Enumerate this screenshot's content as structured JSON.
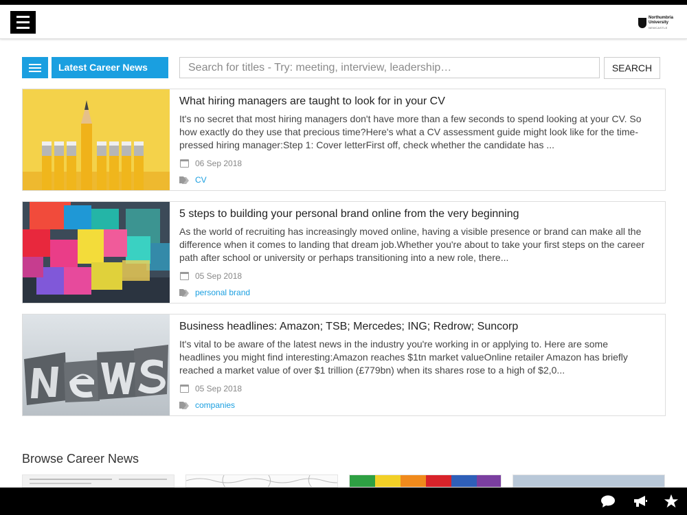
{
  "header": {
    "logo": {
      "line1": "Northumbria",
      "line2": "University",
      "line3": "NEWCASTLE"
    }
  },
  "toolbar": {
    "section_label": "Latest Career News",
    "search_placeholder": "Search for titles - Try: meeting, interview, leadership…",
    "search_value": "",
    "search_button": "SEARCH"
  },
  "articles": [
    {
      "title": "What hiring managers are taught to look for in your CV",
      "excerpt": "It's no secret that most hiring managers don't have more than a few seconds to spend looking at your CV. So how exactly do they use that precious time?Here's what a CV assessment guide might look like for the time-pressed hiring manager:Step 1: Cover letterFirst off, check whether the candidate has ...",
      "date": "06 Sep 2018",
      "tag": "CV",
      "image": "pencils-image"
    },
    {
      "title": "5 steps to building your personal brand online from the very beginning",
      "excerpt": "As the world of recruiting has increasingly moved online, having a visible presence or brand can make all the difference when it comes to landing that dream job.Whether you're about to take your first steps on the career path after school or university or perhaps transitioning into a new role, there...",
      "date": "05 Sep 2018",
      "tag": "personal brand",
      "image": "colored-blocks-image"
    },
    {
      "title": "Business headlines: Amazon; TSB; Mercedes; ING; Redrow; Suncorp",
      "excerpt": "It's vital to be aware of the latest news in the industry you're working in or applying to. Here are some headlines you might find interesting:Amazon reaches $1tn market valueOnline retailer Amazon has briefly reached a market value of over $1 trillion (£779bn) when its shares rose to a high of $2,0...",
      "date": "05 Sep 2018",
      "tag": "companies",
      "image": "news-letterpress-image"
    }
  ],
  "browse": {
    "heading": "Browse Career News"
  },
  "bottom_bar": {
    "icons": [
      "chat-icon",
      "megaphone-icon",
      "star-icon"
    ]
  },
  "colors": {
    "accent": "#1a9fe0",
    "bar": "#000000"
  }
}
